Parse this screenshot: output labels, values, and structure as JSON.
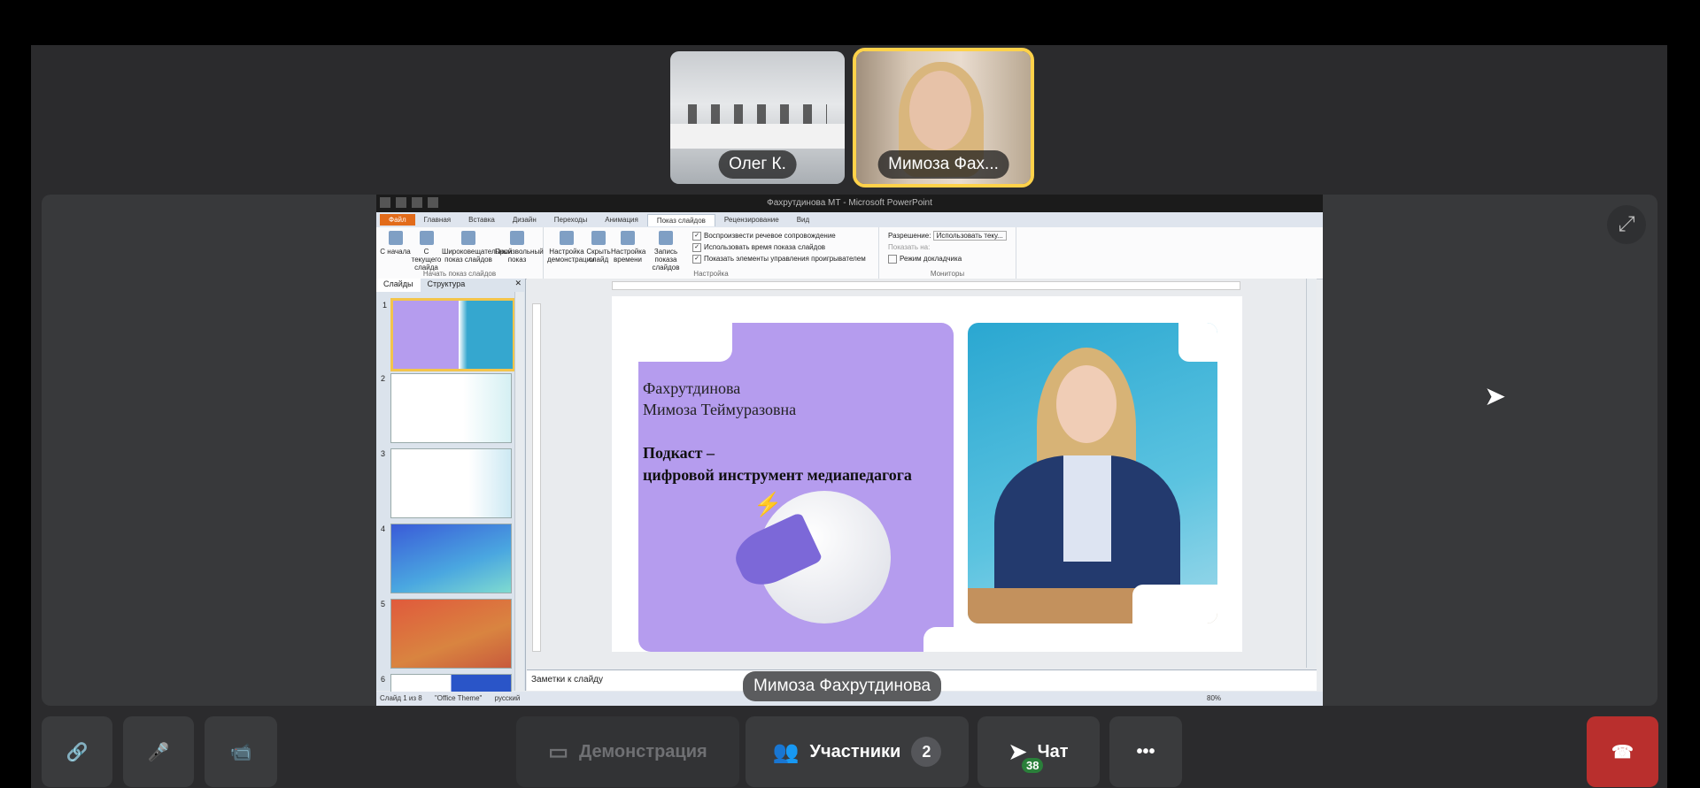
{
  "participants": [
    {
      "name": "Олег К."
    },
    {
      "name": "Мимоза Фах..."
    }
  ],
  "speaker_label": "Мимоза Фахрутдинова",
  "ppt": {
    "window_title": "Фахрутдинова МТ - Microsoft PowerPoint",
    "tabs": [
      "Файл",
      "Главная",
      "Вставка",
      "Дизайн",
      "Переходы",
      "Анимация",
      "Показ слайдов",
      "Рецензирование",
      "Вид"
    ],
    "ribbon": {
      "group1": {
        "buttons": [
          "С начала",
          "С текущего слайда",
          "Широковещательный показ слайдов",
          "Произвольный показ"
        ],
        "label": "Начать показ слайдов"
      },
      "group2": {
        "buttons": [
          "Настройка демонстрации",
          "Скрыть слайд",
          "Настройка времени",
          "Запись показа слайдов"
        ],
        "checks": [
          "Воспроизвести речевое сопровождение",
          "Использовать время показа слайдов",
          "Показать элементы управления проигрывателем"
        ],
        "label": "Настройка"
      },
      "group3": {
        "resolution_label": "Разрешение:",
        "resolution_value": "Использовать теку...",
        "show_on_label": "Показать на:",
        "presenter_label": "Режим докладчика",
        "label": "Мониторы"
      }
    },
    "panel_tabs": [
      "Слайды",
      "Структура"
    ],
    "slide_numbers": [
      "1",
      "2",
      "3",
      "4",
      "5",
      "6"
    ],
    "slide": {
      "name_line1": "Фахрутдинова",
      "name_line2": "Мимоза Теймуразовна",
      "topic_line1": "Подкаст –",
      "topic_line2": "цифровой инструмент медиапедагога"
    },
    "notes_placeholder": "Заметки к слайду",
    "status": {
      "slide_count": "Слайд 1 из 8",
      "theme": "\"Office Theme\"",
      "language": "русский",
      "zoom": "80%"
    }
  },
  "controls": {
    "demo": "Демонстрация",
    "participants": "Участники",
    "participants_count": "2",
    "chat": "Чат",
    "chat_badge": "38"
  },
  "colors": {
    "active_speaker": "#ffd24a",
    "end_call": "#b92f2d",
    "slide_purple": "#b59cee"
  }
}
